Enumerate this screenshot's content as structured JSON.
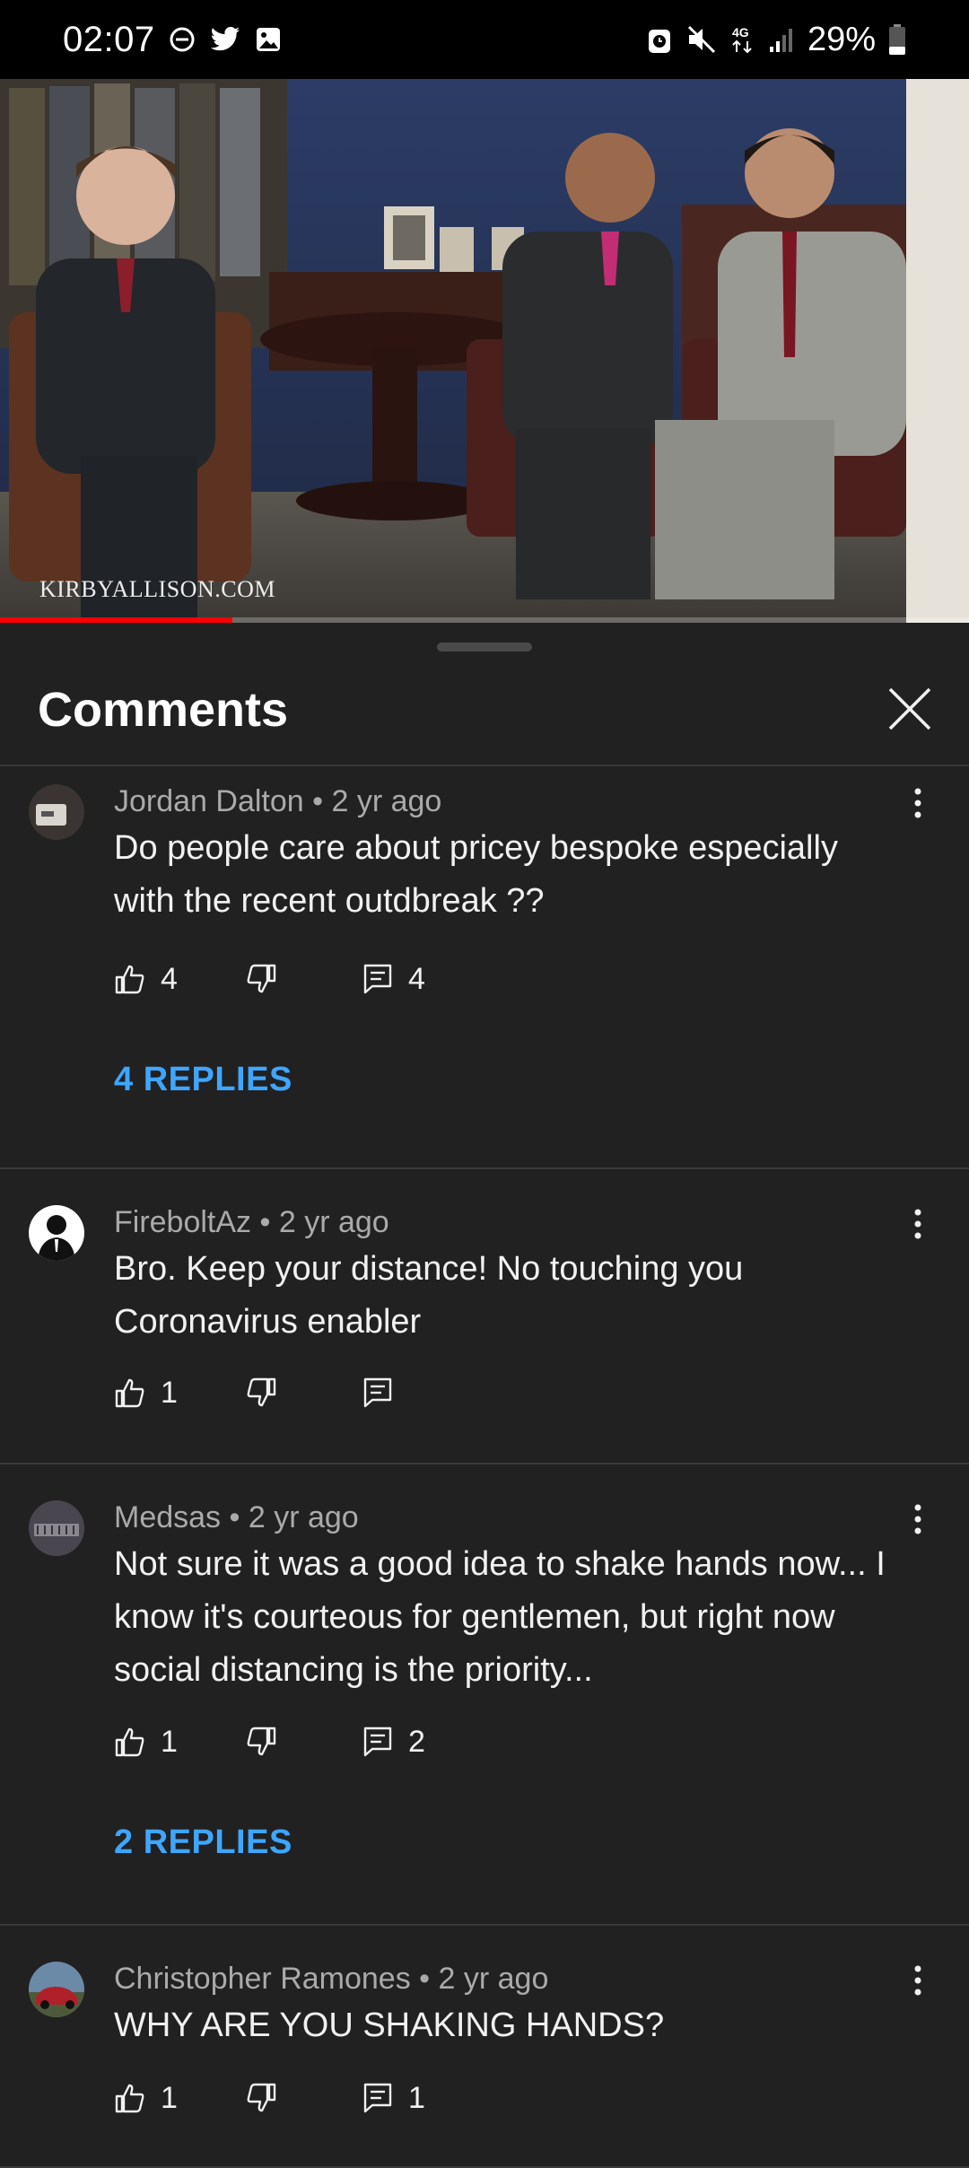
{
  "status_bar": {
    "time": "02:07",
    "left_icons": [
      "do-not-disturb-icon",
      "twitter-icon",
      "gallery-icon"
    ],
    "right_icons": [
      "alarm-icon",
      "mute-icon",
      "4g-icon",
      "signal-icon"
    ],
    "network_label": "4G",
    "battery": "29%",
    "battery_level": 0.29
  },
  "video": {
    "watermark": "KIRBYALLISON.COM",
    "progress": 0.24
  },
  "sheet": {
    "title": "Comments"
  },
  "colors": {
    "background": "#212121",
    "link": "#3ea6ff",
    "meta": "#aaaaaa",
    "progress": "#ff0000"
  },
  "comments": [
    {
      "author": "Jordan Dalton",
      "age": "2 yr ago",
      "meta": "Jordan Dalton • 2 yr ago",
      "text": "Do people care about pricey bespoke especially with the recent outdbreak ??",
      "likes": "4",
      "replies_count": "4",
      "replies_link": "4 REPLIES"
    },
    {
      "author": "FireboltAz",
      "age": "2 yr ago",
      "meta": "FireboltAz • 2 yr ago",
      "text": "Bro. Keep your distance!  No touching you Coronavirus enabler",
      "likes": "1",
      "replies_count": ""
    },
    {
      "author": "Medsas",
      "age": "2 yr ago",
      "meta": "Medsas • 2 yr ago",
      "text": "Not sure it was a good idea to shake hands now... I know it's courteous for gentlemen, but right now social distancing is the priority...",
      "likes": "1",
      "replies_count": "2",
      "replies_link": "2 REPLIES"
    },
    {
      "author": "Christopher Ramones",
      "age": "2 yr ago",
      "meta": "Christopher Ramones • 2 yr ago",
      "text": "WHY ARE YOU SHAKING HANDS?",
      "likes": "1",
      "replies_count": "1"
    }
  ]
}
